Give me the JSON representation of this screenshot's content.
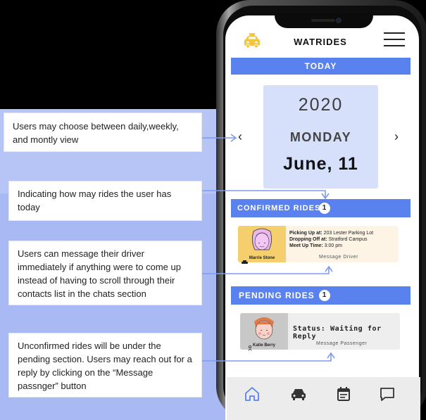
{
  "annotations": [
    "Users may choose between daily,weekly, and montly view",
    "Indicating how may rides the user has today",
    "Users can message their driver immediately if anything were to come up instead of having to scroll through their contacts list in the chats section",
    "Unconfirmed rides will be under the pending section. Users may reach out for a reply by clicking on the “Message passnger” button"
  ],
  "app": {
    "title": "WATRIDES",
    "menu_icon": "hamburger-icon",
    "logo_icon": "taxi-icon"
  },
  "today": {
    "label": "TODAY",
    "year": "2020",
    "weekday": "MONDAY",
    "date": "June, 11",
    "prev_icon": "chevron-left-icon",
    "next_icon": "chevron-right-icon"
  },
  "confirmed": {
    "label": "CONFIRMED RIDES",
    "count": "1",
    "ride": {
      "driver_name": "Marrie Stone",
      "pickup_label": "Picking Up at:",
      "pickup_value": "203 Lester Parking Lot",
      "dropoff_label": "Dropping Off at:",
      "dropoff_value": "Stratford Campus",
      "meetup_label": "Meet Up Time:",
      "meetup_value": "3:00 pm",
      "message_label": "Message Driver"
    }
  },
  "pending": {
    "label": "PENDING RIDES",
    "count": "1",
    "ride": {
      "passenger_name": "Katie Berry",
      "status": "Status: Waiting for Reply",
      "message_label": "Message Passenger"
    }
  },
  "tabs": [
    {
      "icon": "home-icon"
    },
    {
      "icon": "car-icon"
    },
    {
      "icon": "calendar-icon"
    },
    {
      "icon": "chat-icon"
    }
  ],
  "colors": {
    "accent": "#5a82ef",
    "backdrop": "#a9b9f3",
    "date_card": "#d6e0fb",
    "driver_avatar_bg": "#f5cf6e"
  }
}
